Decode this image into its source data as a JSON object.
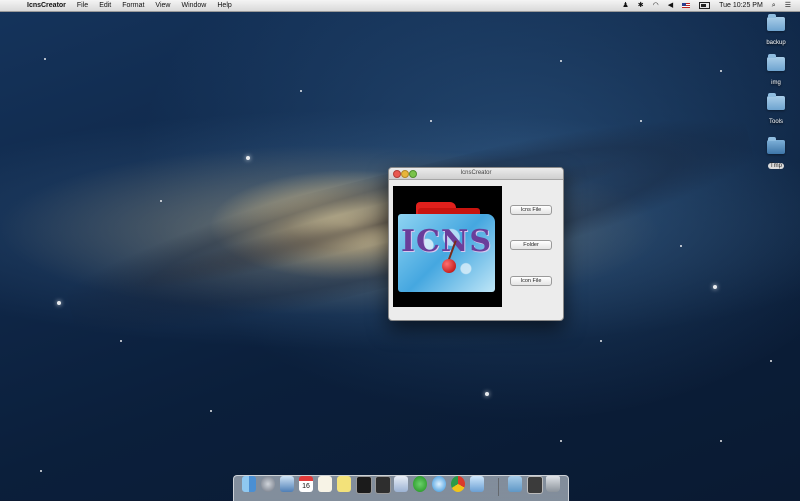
{
  "menubar": {
    "app_name": "IcnsCreator",
    "items": [
      "File",
      "Edit",
      "Format",
      "View",
      "Window",
      "Help"
    ],
    "clock": "Tue 10:25 PM"
  },
  "desktop_icons": [
    {
      "label": "backup",
      "icon": "folder-icon"
    },
    {
      "label": "img",
      "icon": "folder-icon"
    },
    {
      "label": "Tools",
      "icon": "folder-icon"
    },
    {
      "label": "Tmp",
      "icon": "folder-icon",
      "selected": true
    }
  ],
  "window": {
    "title": "IcnsCreator",
    "preview_text": "ICNS",
    "buttons": {
      "icns_file": "Icns File",
      "folder": "Folder",
      "icon_file": "Icon File"
    }
  },
  "dock": {
    "calendar_day": "16",
    "items": [
      "finder-icon",
      "launchpad-icon",
      "mail-icon",
      "calendar-icon",
      "textedit-icon",
      "notes-icon",
      "terminal-icon",
      "activity-monitor-icon",
      "script-editor-icon",
      "appstore-icon",
      "safari-icon",
      "chrome-icon",
      "preview-icon",
      "folder-icon",
      "document-icon",
      "trash-icon"
    ]
  },
  "colors": {
    "menubar": "#e6e6e6",
    "window_bg": "#ececec",
    "accent_red": "#e0201c",
    "icns_text": "#6a3e9a"
  }
}
